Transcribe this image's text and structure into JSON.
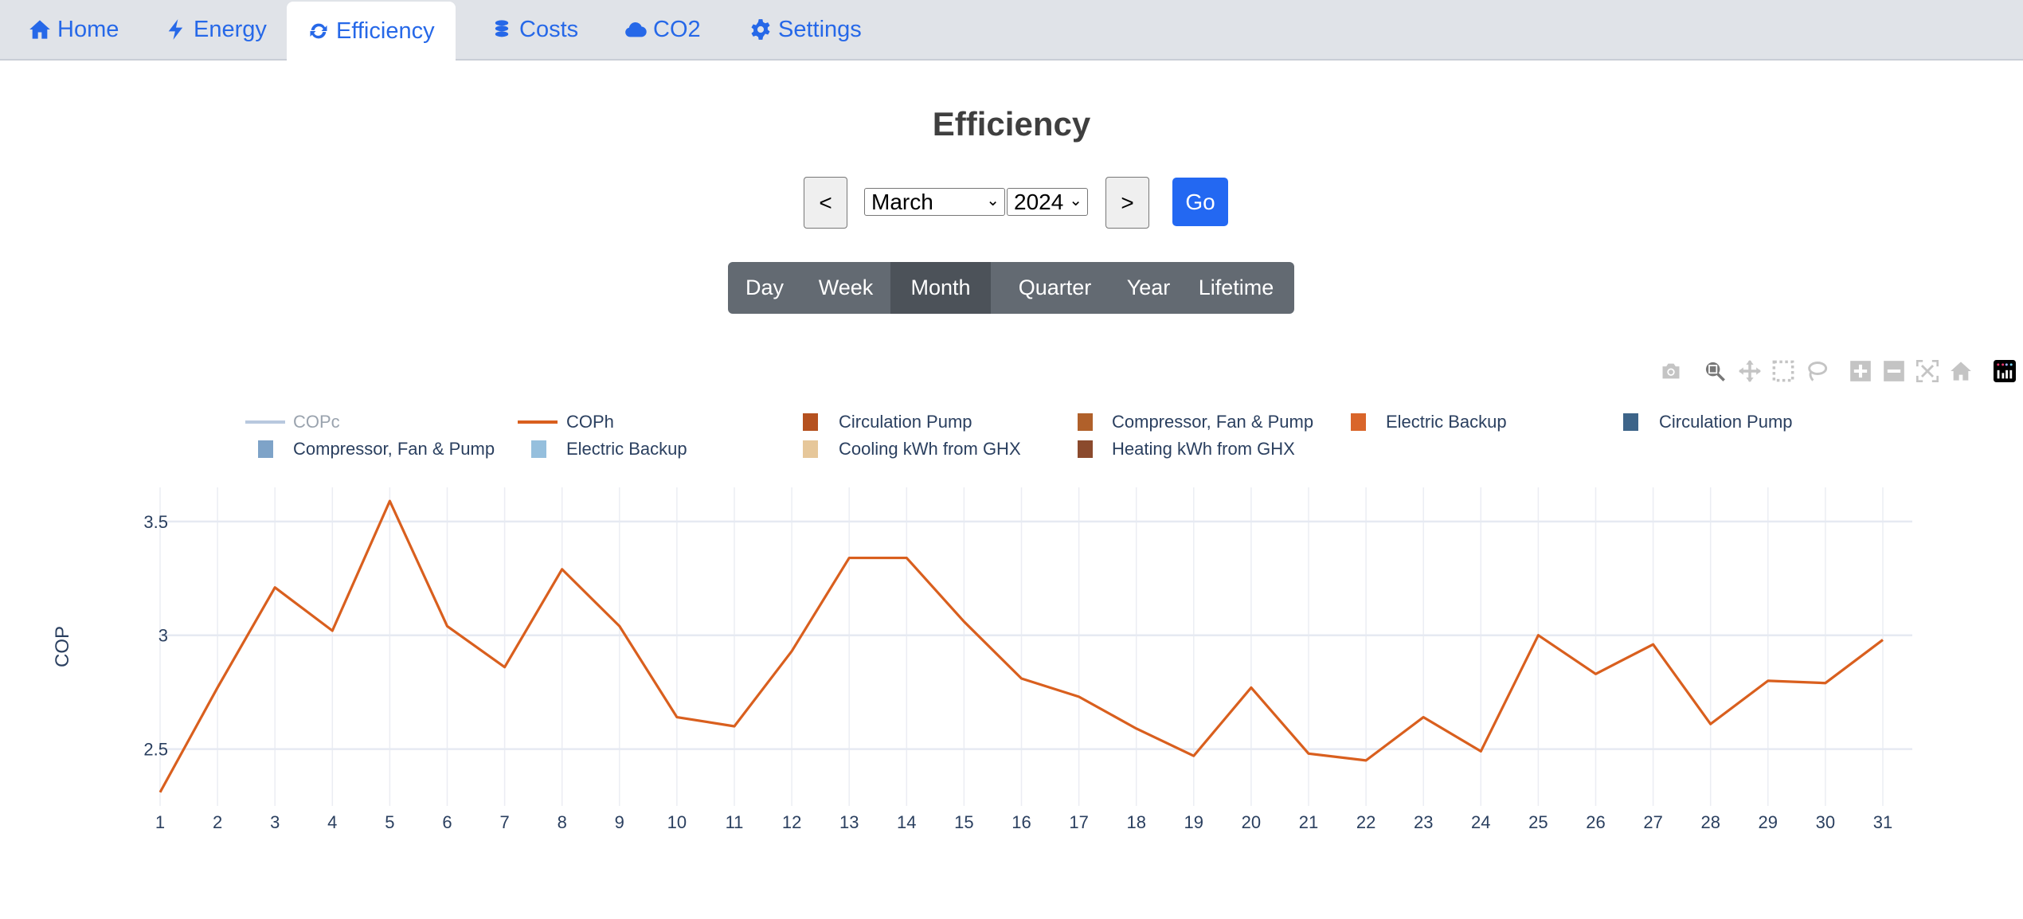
{
  "tabs": [
    {
      "label": "Home",
      "icon": "home-icon"
    },
    {
      "label": "Energy",
      "icon": "bolt-icon"
    },
    {
      "label": "Efficiency",
      "icon": "sync-icon"
    },
    {
      "label": "Costs",
      "icon": "coins-icon"
    },
    {
      "label": "CO2",
      "icon": "cloud-icon"
    },
    {
      "label": "Settings",
      "icon": "gear-icon"
    }
  ],
  "page_title": "Efficiency",
  "controls": {
    "prev": "<",
    "next": ">",
    "month": "March",
    "year": "2024",
    "go": "Go"
  },
  "periods": [
    "Day",
    "Week",
    "Month",
    "Quarter",
    "Year",
    "Lifetime"
  ],
  "active_period": "Month",
  "legend": [
    {
      "label": "COPc",
      "color": "#b8c8de",
      "type": "line"
    },
    {
      "label": "COPh",
      "color": "#d95f1e",
      "type": "line"
    },
    {
      "label": "Circulation Pump",
      "color": "#b5511f",
      "type": "bar"
    },
    {
      "label": "Compressor, Fan & Pump",
      "color": "#b0602a",
      "type": "bar"
    },
    {
      "label": "Electric Backup",
      "color": "#d9652a",
      "type": "bar"
    },
    {
      "label": "Circulation Pump",
      "color": "#3d6489",
      "type": "bar"
    },
    {
      "label": "Compressor, Fan & Pump",
      "color": "#7ea3c8",
      "type": "bar"
    },
    {
      "label": "Electric Backup",
      "color": "#95bfdd",
      "type": "bar"
    },
    {
      "label": "Cooling kWh from GHX",
      "color": "#e6c79a",
      "type": "bar"
    },
    {
      "label": "Heating kWh from GHX",
      "color": "#8b4a2d",
      "type": "bar"
    }
  ],
  "chart_data": {
    "type": "line",
    "ylabel": "COP",
    "xlabel": "",
    "x": [
      1,
      2,
      3,
      4,
      5,
      6,
      7,
      8,
      9,
      10,
      11,
      12,
      13,
      14,
      15,
      16,
      17,
      18,
      19,
      20,
      21,
      22,
      23,
      24,
      25,
      26,
      27,
      28,
      29,
      30,
      31
    ],
    "series": [
      {
        "name": "COPh",
        "color": "#d95f1e",
        "values": [
          2.31,
          2.77,
          3.21,
          3.02,
          3.59,
          3.04,
          2.86,
          3.29,
          3.04,
          2.64,
          2.6,
          2.93,
          3.34,
          3.34,
          3.06,
          2.81,
          2.73,
          2.59,
          2.47,
          2.77,
          2.48,
          2.45,
          2.64,
          2.49,
          3.0,
          2.83,
          2.96,
          2.61,
          2.8,
          2.79,
          2.98
        ]
      }
    ],
    "yticks": [
      "2.5",
      "3",
      "3.5"
    ],
    "ytick_values": [
      2.5,
      3,
      3.5
    ],
    "ylim": [
      2.25,
      3.65
    ],
    "xlim": [
      1,
      31.5
    ],
    "grid": true
  }
}
